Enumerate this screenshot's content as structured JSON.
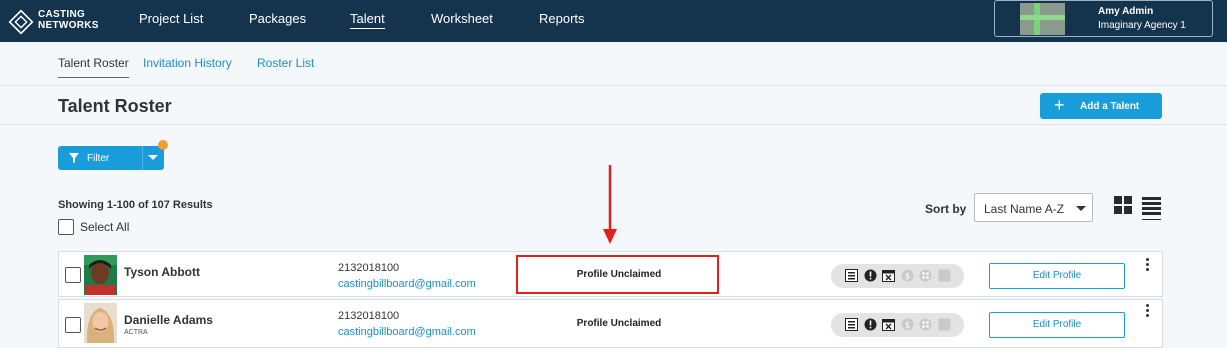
{
  "brand": {
    "line1": "CASTING",
    "line2": "NETWORKS"
  },
  "nav": [
    {
      "label": "Project List"
    },
    {
      "label": "Packages"
    },
    {
      "label": "Talent"
    },
    {
      "label": "Worksheet"
    },
    {
      "label": "Reports"
    }
  ],
  "user": {
    "name": "Amy Admin",
    "agency": "Imaginary Agency 1"
  },
  "tabs": [
    {
      "label": "Talent Roster"
    },
    {
      "label": "Invitation History"
    },
    {
      "label": "Roster List"
    }
  ],
  "page": {
    "title": "Talent Roster",
    "add_label": "Add a Talent"
  },
  "filter": {
    "label": "Filter"
  },
  "results_text": "Showing 1-100 of 107 Results",
  "select_all": "Select All",
  "sort": {
    "label": "Sort by",
    "value": "Last Name A-Z"
  },
  "rows": [
    {
      "name": "Tyson Abbott",
      "union": "",
      "phone": "2132018100",
      "email": "castingbillboard@gmail.com",
      "status": "Profile Unclaimed",
      "edit": "Edit Profile"
    },
    {
      "name": "Danielle Adams",
      "union": "ACTRA",
      "phone": "2132018100",
      "email": "castingbillboard@gmail.com",
      "status": "Profile Unclaimed",
      "edit": "Edit Profile"
    }
  ],
  "colors": {
    "nav_bg": "#14344e",
    "accent": "#1a9ddb",
    "badge": "#f39c34",
    "annotation": "#e0201a"
  }
}
